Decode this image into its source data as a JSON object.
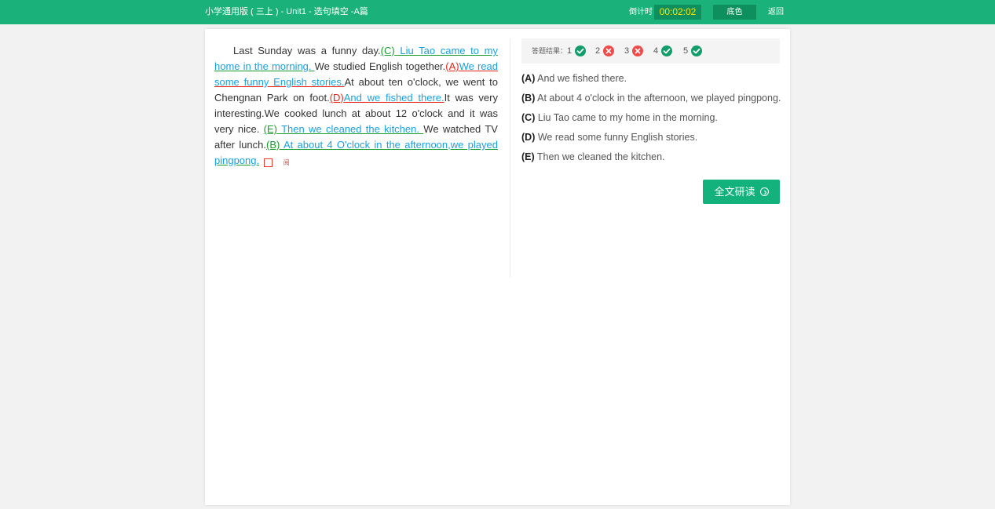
{
  "header": {
    "title": "小学通用版 ( 三上 ) - Unit1 - 选句填空 -A篇",
    "timer_label": "倒计时",
    "timer_value": "00:02:02",
    "bgcolor_label": "底色",
    "back_label": "返回"
  },
  "passage": {
    "s1": "Last Sunday was a funny day.",
    "b1_label": "(C)",
    "b1_text": " Liu Tao came to my home in the morning. ",
    "s2": "We studied English together.",
    "b2_label": "(A)",
    "b2_text": "We read some funny English stories.",
    "s3": "At about ten o'clock, we went to Chengnan Park on foot.",
    "b3_label": "(D)",
    "b3_text": "And we fished there.",
    "s4": "It was very interesting.We cooked lunch at about 12 o'clock and it was very nice.",
    "b4_label": "(E)",
    "b4_text": " Then we cleaned the kitchen. ",
    "s5": "We watched TV after lunch.",
    "b5_label": "(B)",
    "b5_text": " At about 4 O'clock in the afternoon,we played pingpong.",
    "note_glyph": "阅"
  },
  "results": {
    "label": "答题结果：",
    "items": [
      {
        "num": "1",
        "status": "correct"
      },
      {
        "num": "2",
        "status": "wrong"
      },
      {
        "num": "3",
        "status": "wrong"
      },
      {
        "num": "4",
        "status": "correct"
      },
      {
        "num": "5",
        "status": "correct"
      }
    ],
    "colors": {
      "correct": "#139d6b",
      "wrong": "#ef4b4b"
    }
  },
  "options": [
    {
      "letter": "(A)",
      "text": " And we fished there."
    },
    {
      "letter": "(B)",
      "text": " At about 4 o'clock in the afternoon, we played pingpong."
    },
    {
      "letter": "(C)",
      "text": " Liu Tao came to my home in the morning."
    },
    {
      "letter": "(D)",
      "text": " We read some funny English stories."
    },
    {
      "letter": "(E)",
      "text": " Then we cleaned the kitchen."
    }
  ],
  "fulltext_button": {
    "label": "全文研读",
    "icon": "chevron-right-circle-icon"
  },
  "colors": {
    "brand": "#1ab27a",
    "timer_text": "#ffe600",
    "answer_blue": "#1aa0e0",
    "label_green": "#1a9b2f",
    "label_red": "#e8251b"
  }
}
